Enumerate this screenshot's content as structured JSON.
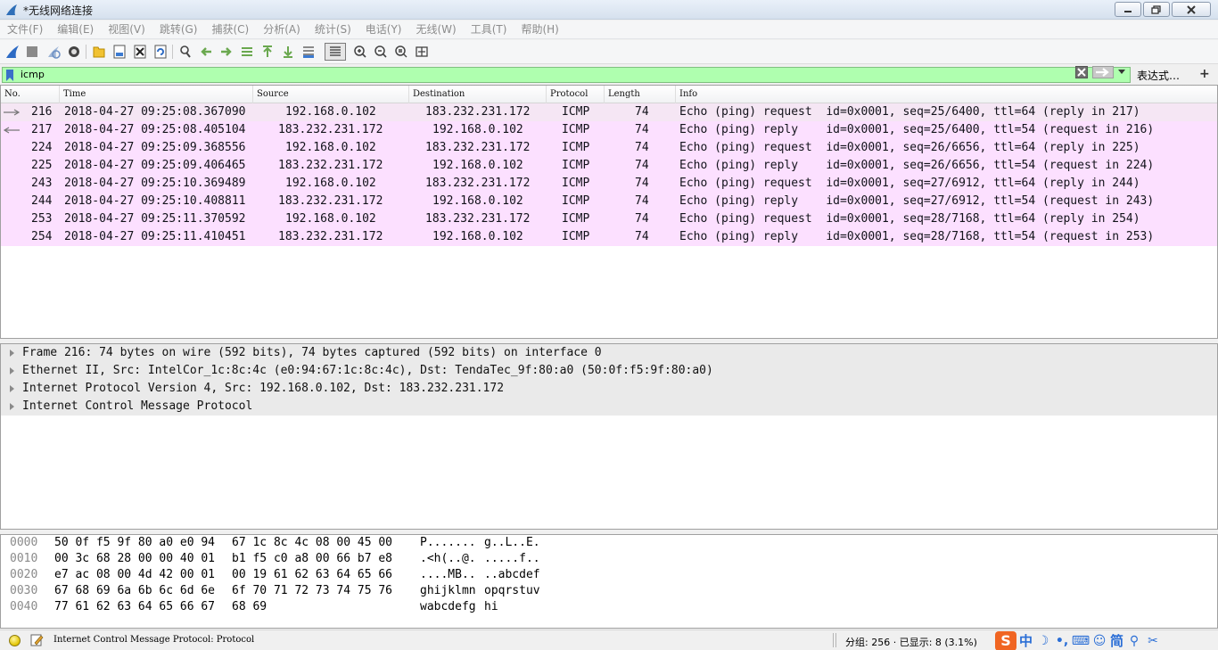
{
  "window": {
    "title": "*无线网络连接"
  },
  "menu": [
    {
      "label": "文件(F)"
    },
    {
      "label": "编辑(E)"
    },
    {
      "label": "视图(V)"
    },
    {
      "label": "跳转(G)"
    },
    {
      "label": "捕获(C)"
    },
    {
      "label": "分析(A)"
    },
    {
      "label": "统计(S)"
    },
    {
      "label": "电话(Y)"
    },
    {
      "label": "无线(W)"
    },
    {
      "label": "工具(T)"
    },
    {
      "label": "帮助(H)"
    }
  ],
  "filter": {
    "value": "icmp",
    "expression_label": "表达式…",
    "add_label": "+"
  },
  "packet_list": {
    "columns": [
      "No.",
      "Time",
      "Source",
      "Destination",
      "Protocol",
      "Length",
      "Info"
    ],
    "rows": [
      {
        "no": "216",
        "time": "2018-04-27 09:25:08.367090",
        "source": "192.168.0.102",
        "destination": "183.232.231.172",
        "protocol": "ICMP",
        "length": "74",
        "info": "Echo (ping) request  id=0x0001, seq=25/6400, ttl=64 (reply in 217)"
      },
      {
        "no": "217",
        "time": "2018-04-27 09:25:08.405104",
        "source": "183.232.231.172",
        "destination": "192.168.0.102",
        "protocol": "ICMP",
        "length": "74",
        "info": "Echo (ping) reply    id=0x0001, seq=25/6400, ttl=54 (request in 216)"
      },
      {
        "no": "224",
        "time": "2018-04-27 09:25:09.368556",
        "source": "192.168.0.102",
        "destination": "183.232.231.172",
        "protocol": "ICMP",
        "length": "74",
        "info": "Echo (ping) request  id=0x0001, seq=26/6656, ttl=64 (reply in 225)"
      },
      {
        "no": "225",
        "time": "2018-04-27 09:25:09.406465",
        "source": "183.232.231.172",
        "destination": "192.168.0.102",
        "protocol": "ICMP",
        "length": "74",
        "info": "Echo (ping) reply    id=0x0001, seq=26/6656, ttl=54 (request in 224)"
      },
      {
        "no": "243",
        "time": "2018-04-27 09:25:10.369489",
        "source": "192.168.0.102",
        "destination": "183.232.231.172",
        "protocol": "ICMP",
        "length": "74",
        "info": "Echo (ping) request  id=0x0001, seq=27/6912, ttl=64 (reply in 244)"
      },
      {
        "no": "244",
        "time": "2018-04-27 09:25:10.408811",
        "source": "183.232.231.172",
        "destination": "192.168.0.102",
        "protocol": "ICMP",
        "length": "74",
        "info": "Echo (ping) reply    id=0x0001, seq=27/6912, ttl=54 (request in 243)"
      },
      {
        "no": "253",
        "time": "2018-04-27 09:25:11.370592",
        "source": "192.168.0.102",
        "destination": "183.232.231.172",
        "protocol": "ICMP",
        "length": "74",
        "info": "Echo (ping) request  id=0x0001, seq=28/7168, ttl=64 (reply in 254)"
      },
      {
        "no": "254",
        "time": "2018-04-27 09:25:11.410451",
        "source": "183.232.231.172",
        "destination": "192.168.0.102",
        "protocol": "ICMP",
        "length": "74",
        "info": "Echo (ping) reply    id=0x0001, seq=28/7168, ttl=54 (request in 253)"
      }
    ]
  },
  "details": [
    "Frame 216: 74 bytes on wire (592 bits), 74 bytes captured (592 bits) on interface 0",
    "Ethernet II, Src: IntelCor_1c:8c:4c (e0:94:67:1c:8c:4c), Dst: TendaTec_9f:80:a0 (50:0f:f5:9f:80:a0)",
    "Internet Protocol Version 4, Src: 192.168.0.102, Dst: 183.232.231.172",
    "Internet Control Message Protocol"
  ],
  "bytes": [
    {
      "offset": "0000",
      "hex1": "50 0f f5 9f 80 a0 e0 94",
      "hex2": "67 1c 8c 4c 08 00 45 00",
      "ascii1": "P.......",
      "ascii2": "g..L..E."
    },
    {
      "offset": "0010",
      "hex1": "00 3c 68 28 00 00 40 01",
      "hex2": "b1 f5 c0 a8 00 66 b7 e8",
      "ascii1": ".<h(..@.",
      "ascii2": ".....f.."
    },
    {
      "offset": "0020",
      "hex1": "e7 ac 08 00 4d 42 00 01",
      "hex2": "00 19 61 62 63 64 65 66",
      "ascii1": "....MB..",
      "ascii2": "..abcdef"
    },
    {
      "offset": "0030",
      "hex1": "67 68 69 6a 6b 6c 6d 6e",
      "hex2": "6f 70 71 72 73 74 75 76",
      "ascii1": "ghijklmn",
      "ascii2": "opqrstuv"
    },
    {
      "offset": "0040",
      "hex1": "77 61 62 63 64 65 66 67",
      "hex2": "68 69",
      "ascii1": "wabcdefg",
      "ascii2": "hi"
    }
  ],
  "status": {
    "text": "Internet Control Message Protocol: Protocol",
    "counts": "分组: 256 · 已显示: 8 (3.1%)",
    "ime_logo": "S",
    "ime_lang": "中",
    "ime_mode": "简"
  },
  "colors": {
    "row_bg": "#fce0ff",
    "filter_bg": "#afffaf",
    "details_bg": "#eaeaea"
  }
}
